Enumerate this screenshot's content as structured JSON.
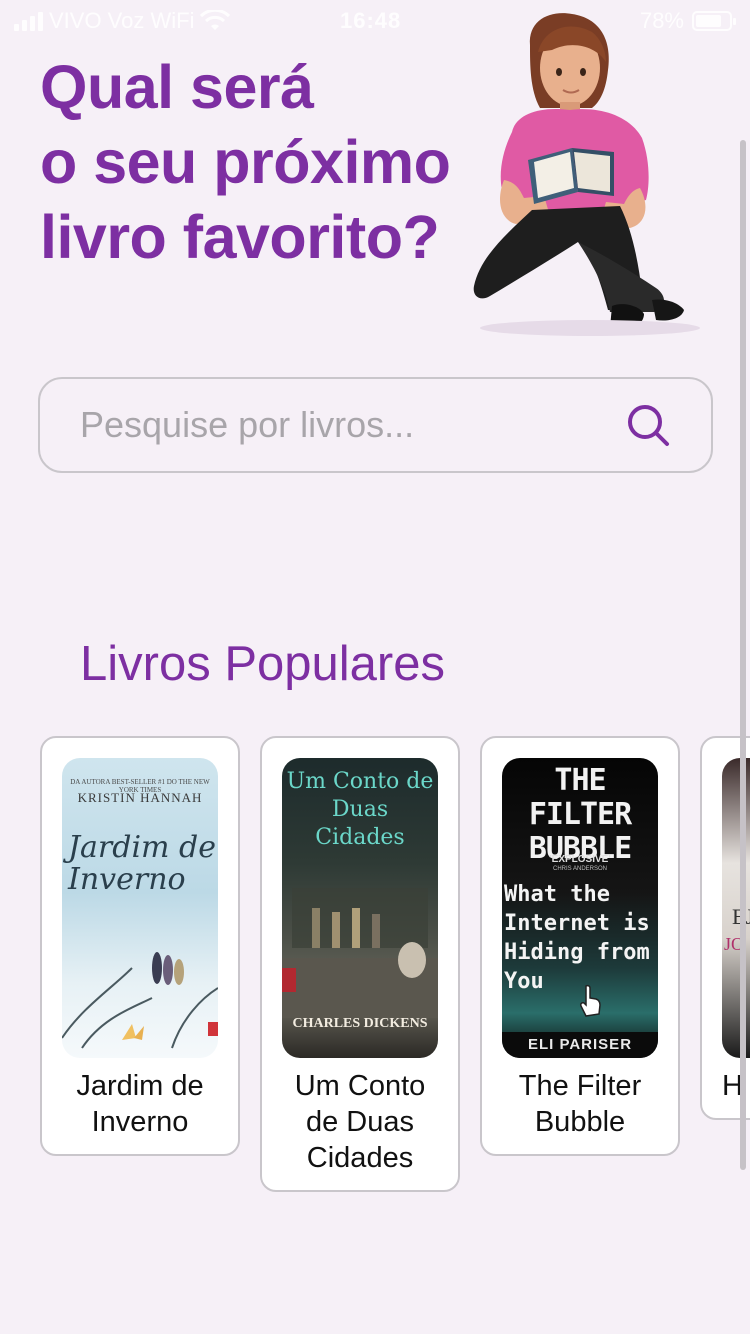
{
  "status_bar": {
    "carrier": "VIVO Voz WiFi",
    "time": "16:48",
    "battery": "78%",
    "battery_level": 0.78
  },
  "hero": {
    "title_lines": [
      "Qual será",
      "o seu próximo",
      "livro favorito?"
    ],
    "illustration": "woman-reading-book"
  },
  "search": {
    "placeholder": "Pesquise por livros...",
    "value": "",
    "icon": "search-icon"
  },
  "popular": {
    "title": "Livros Populares",
    "books": [
      {
        "title_lines": [
          "Jardim de",
          "Inverno"
        ],
        "cover": {
          "tagline": "DA AUTORA BEST-SELLER #1 DO THE NEW YORK TIMES",
          "author": "KRISTIN HANNAH",
          "title": "Jardim de Inverno"
        }
      },
      {
        "title_lines": [
          "Um Conto",
          "de Duas",
          "Cidades"
        ],
        "cover": {
          "title": "Um Conto de Duas Cidades",
          "author": "CHARLES DICKENS"
        }
      },
      {
        "title_lines": [
          "The Filter",
          "Bubble"
        ],
        "cover": {
          "title": "THE FILTER BUBBLE",
          "quote": "'EXPLOSIVE'",
          "quote_author": "CHRIS ANDERSON",
          "subtitle": "What the Internet is Hiding from You",
          "author": "ELI PARISER"
        }
      },
      {
        "title_lines": [
          "H"
        ],
        "cover": {
          "title": "EJ",
          "author": "JO"
        }
      }
    ]
  },
  "colors": {
    "background": "#f6f0f7",
    "accent": "#7d2fa2",
    "border": "#c9c6cb"
  }
}
